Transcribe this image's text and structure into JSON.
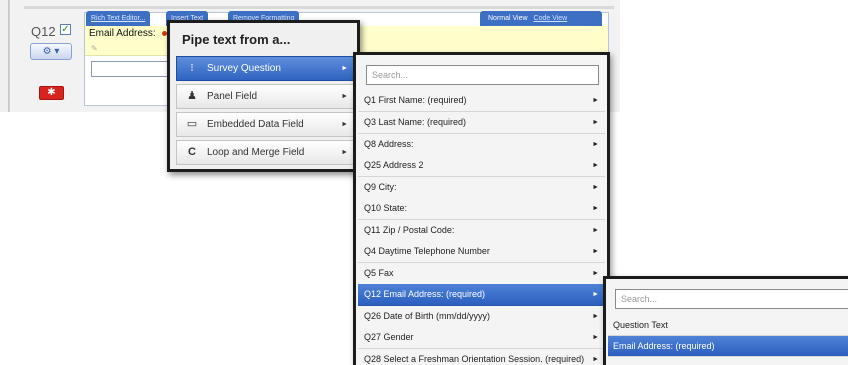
{
  "question": {
    "number": "Q12",
    "checkbox_mark": "✓",
    "gear_button": "⚙ ▾",
    "delete_button": "✱",
    "field_label": "Email Address:",
    "editor_icon": "✎"
  },
  "toolbar": {
    "rich_text_editor": "Rich Text Editor...",
    "insert_text": "Insert Text",
    "remove_formatting": "Remove Formatting",
    "normal_view": "Normal View",
    "code_view": "Code View"
  },
  "pipe_menu": {
    "title": "Pipe text from a...",
    "items": [
      {
        "label": "Survey Question",
        "icon": "survey-question-icon",
        "glyph": "⁝",
        "active": true
      },
      {
        "label": "Panel Field",
        "icon": "panel-field-icon",
        "glyph": "♟",
        "active": false
      },
      {
        "label": "Embedded Data Field",
        "icon": "embedded-data-icon",
        "glyph": "▭",
        "active": false
      },
      {
        "label": "Loop and Merge Field",
        "icon": "loop-merge-icon",
        "glyph": "C",
        "active": false
      }
    ],
    "arrow": "►"
  },
  "question_list": {
    "search_placeholder": "Search...",
    "items": [
      {
        "label": "Q1 First Name: (required)",
        "active": false
      },
      {
        "label": "Q3 Last Name: (required)",
        "active": false
      },
      {
        "label": "Q8 Address:",
        "active": false
      },
      {
        "label": "Q25 Address 2",
        "active": false
      },
      {
        "label": "Q9 City:",
        "active": false
      },
      {
        "label": "Q10 State:",
        "active": false
      },
      {
        "label": "Q11 Zip / Postal Code:",
        "active": false
      },
      {
        "label": "Q4 Daytime Telephone Number",
        "active": false
      },
      {
        "label": "Q5 Fax",
        "active": false
      },
      {
        "label": "Q12 Email Address: (required)",
        "active": true
      },
      {
        "label": "Q26 Date of Birth (mm/dd/yyyy)",
        "active": false
      },
      {
        "label": "Q27 Gender",
        "active": false
      },
      {
        "label": "Q28 Select a Freshman Orientation Session. (required)",
        "active": false
      }
    ],
    "arrow": "►"
  },
  "answer_list": {
    "search_placeholder": "Search...",
    "items": [
      {
        "label": "Question Text",
        "active": false
      },
      {
        "label": "Email Address: (required)",
        "active": true
      }
    ]
  },
  "colors": {
    "highlight_blue": "#2f63c0",
    "yellow_row": "#ffffcc",
    "delete_red": "#d8231f"
  }
}
